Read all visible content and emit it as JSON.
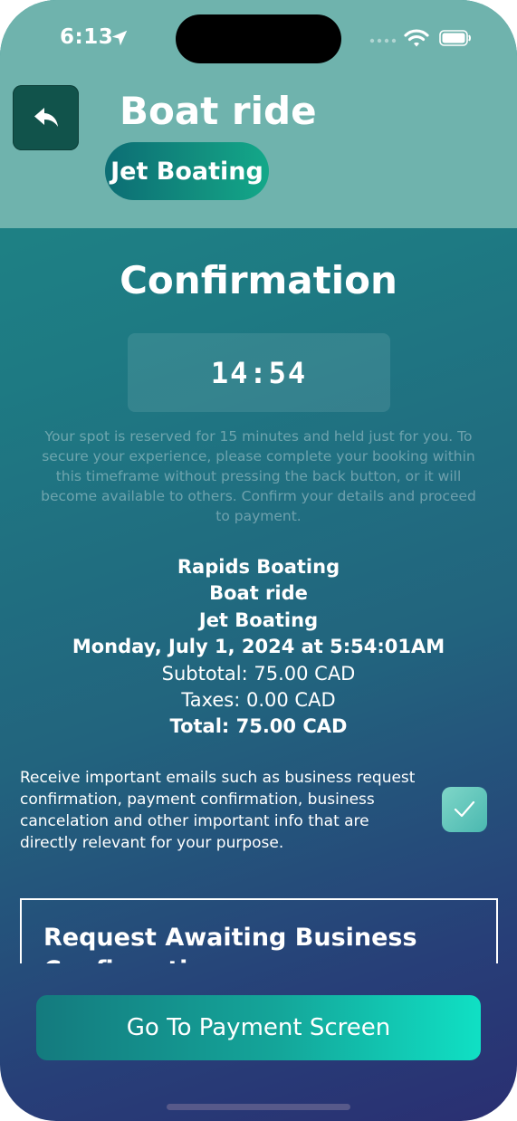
{
  "status": {
    "time": "6:13"
  },
  "header": {
    "title": "Boat ride",
    "category_pill": "Jet Boating"
  },
  "confirmation": {
    "title": "Confirmation",
    "timer": "14:54",
    "notice": "Your spot is reserved for 15 minutes and held just for you. To secure your experience, please complete your booking within this timeframe without pressing the back button, or it will become available to others. Confirm your details and proceed to payment."
  },
  "booking": {
    "business": "Rapids Boating",
    "activity": "Boat ride",
    "category": "Jet Boating",
    "datetime": "Monday, July 1, 2024 at 5:54:01AM",
    "subtotal": "Subtotal: 75.00 CAD",
    "taxes": "Taxes: 0.00 CAD",
    "total": "Total: 75.00 CAD"
  },
  "consent": {
    "text": "Receive important emails such as business request confirmation, payment confirmation, business cancelation and other important info that are directly relevant for your purpose.",
    "checked": true
  },
  "request_box": {
    "title": "Request Awaiting Business Confirmation"
  },
  "actions": {
    "payment_button": "Go To Payment Screen"
  },
  "colors": {
    "header_bg": "#6fb3ad",
    "back_button": "#11534b",
    "accent_gradient_start": "#147a7e",
    "accent_gradient_end": "#10e0c4"
  },
  "icons": {
    "back": "reply-arrow-icon",
    "location": "location-arrow-icon",
    "wifi": "wifi-icon",
    "battery": "battery-icon",
    "signal": "cellular-signal-icon",
    "checkbox": "checkmark-icon"
  }
}
